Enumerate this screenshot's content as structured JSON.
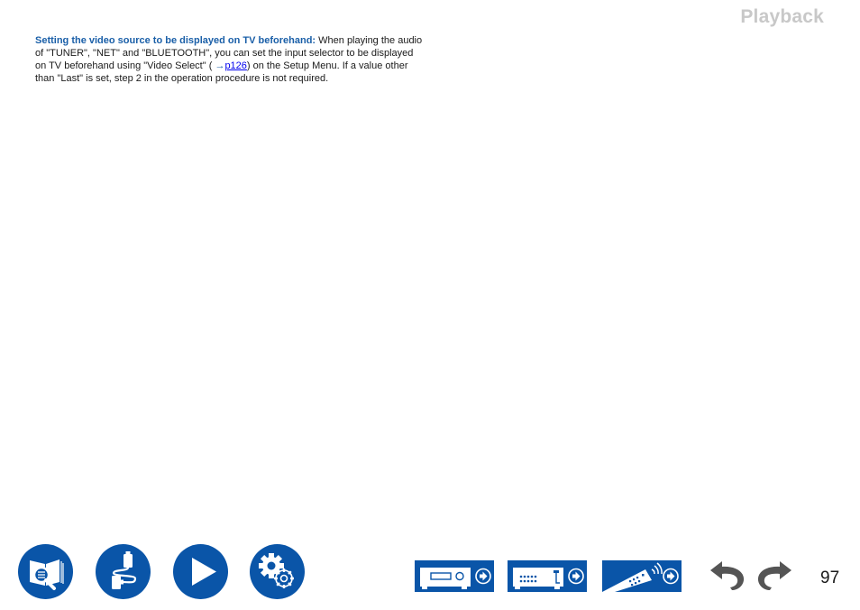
{
  "header": {
    "section_title": "Playback"
  },
  "note": {
    "lead": "Setting the video source to be displayed on TV beforehand:",
    "text_1": " When playing the audio of \"TUNER\", \"NET\" and \"BLUETOOTH\", you can set the input selector to be displayed on TV beforehand using \"Video Select\" ( ",
    "xref_arrow": "→",
    "xref_label": "p126",
    "text_2": ") on the Setup Menu. If a value other than \"Last\" is set, step 2 in the operation procedure is not required."
  },
  "footer": {
    "nav_icons": [
      {
        "name": "contents-search-icon"
      },
      {
        "name": "connections-icon"
      },
      {
        "name": "playback-icon"
      },
      {
        "name": "setup-icon"
      }
    ],
    "device_buttons": [
      {
        "name": "front-panel"
      },
      {
        "name": "rear-panel"
      },
      {
        "name": "remote"
      }
    ],
    "back_label": "back",
    "forward_label": "forward",
    "page_number": "97"
  },
  "colors": {
    "brand_blue": "#0a55a8",
    "link_blue": "#1a5fa8",
    "title_gray": "#c8c8c8",
    "arrow_gray": "#555555"
  }
}
